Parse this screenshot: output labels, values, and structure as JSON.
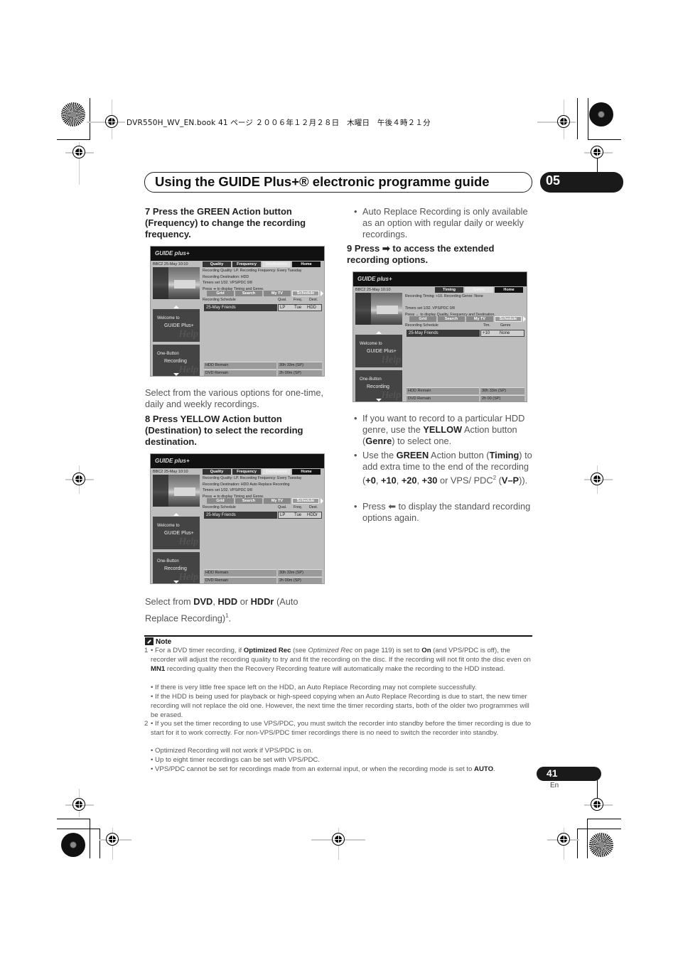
{
  "print_header": "DVR550H_WV_EN.book  41 ページ  ２００６年１２月２８日　木曜日　午後４時２１分",
  "header": {
    "title": "Using the GUIDE Plus+® electronic programme guide",
    "chapter": "05"
  },
  "left_column": {
    "step7": "7    Press the GREEN Action button (Frequency) to change the recording frequency.",
    "screen1": {
      "logo": "GUIDE plus+",
      "channel": "BBC2   25-May  10:10",
      "tabs": [
        "Quality",
        "Frequency",
        "Destination",
        "Home"
      ],
      "info_lines": [
        "Recording Quality: LP. Recording Frequency: Every Tuesday",
        "Recording Destination: HDD",
        "Timers set 1/32. VPS/PDC 0/8",
        "Press ➜ to display Timing and Genre."
      ],
      "nav": [
        "Grid",
        "Search",
        "My TV",
        "Schedule"
      ],
      "schedule_header": {
        "label": "Recording Schedule",
        "cols": [
          "Qual.",
          "Freq.",
          "Dest."
        ]
      },
      "schedule_row": {
        "name": "25-May  Friends",
        "values": [
          "LP",
          "Tue",
          "HDD"
        ]
      },
      "promo1": {
        "line1": "Welcome to",
        "line2": "GUIDE Plus+",
        "watermark": "Help"
      },
      "promo2": {
        "line1": "One-Button",
        "line2": "Recording",
        "watermark": "Help"
      },
      "remain": [
        {
          "label": "HDD Remain",
          "value": "30h 33m (SP)"
        },
        {
          "label": "DVD Remain",
          "value": "2h 00m (SP)"
        }
      ]
    },
    "para1": "Select from the various options for one-time, daily and weekly recordings.",
    "step8": "8    Press YELLOW Action button (Destination) to select the recording destination.",
    "screen2": {
      "logo": "GUIDE plus+",
      "channel": "BBC2   25-May  10:10",
      "tabs": [
        "Quality",
        "Frequency",
        "Destination",
        "Home"
      ],
      "info_lines": [
        "Recording Quality: LP. Recording Frequency: Every Tuesday",
        "Recording Destination: HDD Auto Replace Recording",
        "Timers set 1/32. VPS/PDC 0/8",
        "Press ➜ to display Timing and Genre."
      ],
      "nav": [
        "Grid",
        "Search",
        "My TV",
        "Schedule"
      ],
      "schedule_header": {
        "label": "Recording Schedule",
        "cols": [
          "Qual.",
          "Freq.",
          "Dest."
        ]
      },
      "schedule_row": {
        "name": "25-May  Friends",
        "values": [
          "LP",
          "Tue",
          "HDDr"
        ]
      },
      "promo1": {
        "line1": "Welcome to",
        "line2": "GUIDE Plus+",
        "watermark": "Help"
      },
      "promo2": {
        "line1": "One-Button",
        "line2": "Recording",
        "watermark": "Help"
      },
      "remain": [
        {
          "label": "HDD Remain",
          "value": "30h 33m (SP)"
        },
        {
          "label": "DVD Remain",
          "value": "2h 00m (SP)"
        }
      ]
    },
    "para2": {
      "pre": "Select from ",
      "b1": "DVD",
      "sep1": ", ",
      "b2": "HDD",
      "sep2": " or ",
      "b3": "HDDr",
      "post": " (Auto Replace Recording)",
      "sup": "1",
      "end": "."
    }
  },
  "right_column": {
    "bullet1": "Auto Replace Recording is only available as an option with regular daily or weekly recordings.",
    "step9": "9    Press ➡ to access the extended recording options.",
    "screen3": {
      "logo": "GUIDE plus+",
      "channel": "BBC2   25-May  10:10",
      "tabs": [
        "Timing",
        "Genre",
        "Home"
      ],
      "info_lines": [
        "Recording Timing: +10. Recording Genre: None",
        "",
        "Timers set 1/32. VPS/PDC 0/8",
        "Press ← to display Quality, Frequency and Destination."
      ],
      "nav": [
        "Grid",
        "Search",
        "My TV",
        "Schedule"
      ],
      "schedule_header": {
        "label": "Recording Schedule",
        "cols": [
          "Tim.",
          "Genre"
        ]
      },
      "schedule_row": {
        "name": "25-May  Friends",
        "values": [
          "+10",
          "None"
        ]
      },
      "promo1": {
        "line1": "Welcome to",
        "line2": "GUIDE Plus+",
        "watermark": "Help"
      },
      "promo2": {
        "line1": "One-Button",
        "line2": "Recording",
        "watermark": "Help"
      },
      "remain": [
        {
          "label": "HDD Remain",
          "value": "30h 33m (SP)"
        },
        {
          "label": "DVD Remain",
          "value": "2h 00 (SP)"
        }
      ]
    },
    "bullet2": {
      "pre": "If you want to record to a particular HDD genre, use the ",
      "b1": "YELLOW",
      "mid": " Action button (",
      "b2": "Genre",
      "post": ") to select one."
    },
    "bullet3": {
      "pre": "Use the ",
      "b1": "GREEN",
      "mid": " Action button (",
      "b2": "Timing",
      "mid2": ") to add extra time to the end of the recording (",
      "v1": "+0",
      "v2": "+10",
      "v3": "+20",
      "v4": "+30",
      "mid3": " or VPS/ PDC",
      "sup": "2",
      "mid4": " (",
      "v5": "V–P",
      "end": "))."
    },
    "bullet4": "Press ⬅ to display the standard recording options again."
  },
  "note": {
    "heading": "Note",
    "n1_num": "1",
    "n1a": {
      "pre": "• For a DVD timer recording, if ",
      "b1": "Optimized Rec",
      "mid": " (see ",
      "i1": "Optimized Rec",
      "mid2": " on page 119) is set to ",
      "b2": "On",
      "mid3": " (and VPS/PDC is off), the recorder will adjust the recording quality to try and fit the recording on the disc. If the recording will not fit onto the disc even on ",
      "b3": "MN1",
      "end": " recording quality then the Recovery Recording feature will automatically make the recording to the HDD instead."
    },
    "n1b": "• If there is very little free space left on the HDD, an Auto Replace Recording may not complete successfully.",
    "n1c": "• If the HDD is being used for playback or high-speed copying when an Auto Replace Recording is due to start, the new timer recording will not replace the old one. However, the next time the timer recording starts, both of the older two programmes will be erased.",
    "n2_num": "2",
    "n2a": "• If you set the timer recording to use VPS/PDC, you must switch the recorder into standby before the timer recording is due to start for it to work correctly. For non-VPS/PDC timer recordings there is no need to switch the recorder into standby.",
    "n2b": "• Optimized Recording will not work if VPS/PDC is on.",
    "n2c": "• Up to eight timer recordings can be set with VPS/PDC.",
    "n2d": {
      "pre": "• VPS/PDC cannot be set for recordings made from an external input, or when the recording mode is set to ",
      "b1": "AUTO",
      "end": "."
    }
  },
  "footer": {
    "page": "41",
    "lang": "En"
  }
}
